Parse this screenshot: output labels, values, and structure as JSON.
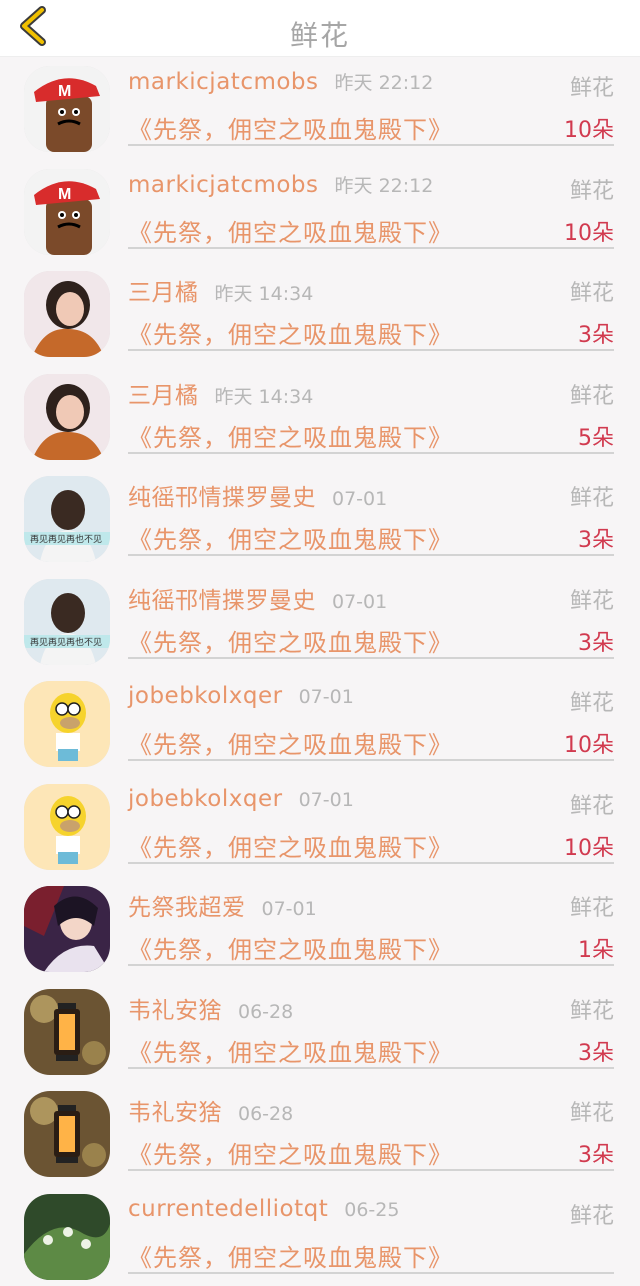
{
  "header": {
    "title": "鲜花",
    "back_icon": "chevron-left-icon",
    "accent_color": "#f0c000"
  },
  "records": [
    {
      "name": "markicjatcmobs",
      "time": "昨天 22:12",
      "type": "鲜花",
      "work": "《先祭，佣空之吸血鬼殿下》",
      "count": "10朵",
      "avatar": "red-cap-cartoon"
    },
    {
      "name": "markicjatcmobs",
      "time": "昨天 22:12",
      "type": "鲜花",
      "work": "《先祭，佣空之吸血鬼殿下》",
      "count": "10朵",
      "avatar": "red-cap-cartoon"
    },
    {
      "name": "三月橘",
      "time": "昨天 14:34",
      "type": "鲜花",
      "work": "《先祭，佣空之吸血鬼殿下》",
      "count": "3朵",
      "avatar": "girl-portrait"
    },
    {
      "name": "三月橘",
      "time": "昨天 14:34",
      "type": "鲜花",
      "work": "《先祭，佣空之吸血鬼殿下》",
      "count": "5朵",
      "avatar": "girl-portrait"
    },
    {
      "name": "纯徭邗情揲罗曼史",
      "time": "07-01",
      "type": "鲜花",
      "work": "《先祭，佣空之吸血鬼殿下》",
      "count": "3朵",
      "avatar": "girl-back-caption"
    },
    {
      "name": "纯徭邗情揲罗曼史",
      "time": "07-01",
      "type": "鲜花",
      "work": "《先祭，佣空之吸血鬼殿下》",
      "count": "3朵",
      "avatar": "girl-back-caption"
    },
    {
      "name": "jobebkolxqer",
      "time": "07-01",
      "type": "鲜花",
      "work": "《先祭，佣空之吸血鬼殿下》",
      "count": "10朵",
      "avatar": "yellow-cartoon"
    },
    {
      "name": "jobebkolxqer",
      "time": "07-01",
      "type": "鲜花",
      "work": "《先祭，佣空之吸血鬼殿下》",
      "count": "10朵",
      "avatar": "yellow-cartoon"
    },
    {
      "name": "先祭我超爱",
      "time": "07-01",
      "type": "鲜花",
      "work": "《先祭，佣空之吸血鬼殿下》",
      "count": "1朵",
      "avatar": "anime-art"
    },
    {
      "name": "韦礼安猞",
      "time": "06-28",
      "type": "鲜花",
      "work": "《先祭，佣空之吸血鬼殿下》",
      "count": "3朵",
      "avatar": "lantern"
    },
    {
      "name": "韦礼安猞",
      "time": "06-28",
      "type": "鲜花",
      "work": "《先祭，佣空之吸血鬼殿下》",
      "count": "3朵",
      "avatar": "lantern"
    },
    {
      "name": "currentedelliotqt",
      "time": "06-25",
      "type": "鲜花",
      "work": "《先祭，佣空之吸血鬼殿下》",
      "count": "",
      "avatar": "green-leaves"
    }
  ],
  "avatar_caption": "再见再见再也不见"
}
